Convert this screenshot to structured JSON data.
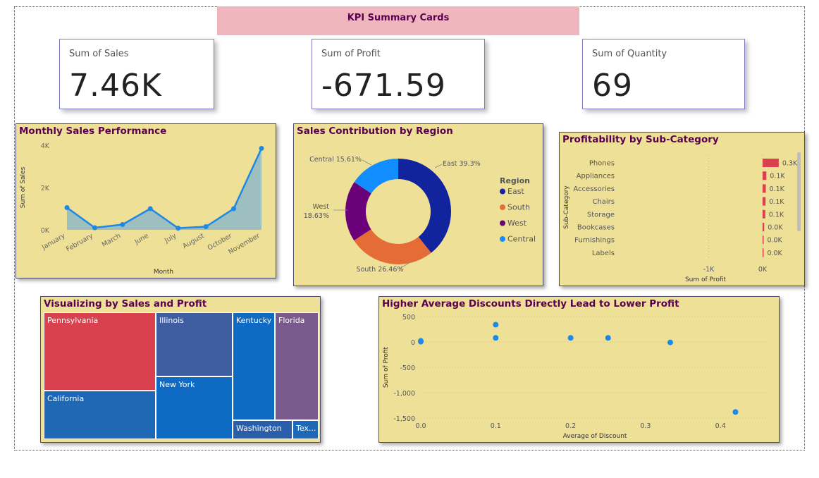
{
  "banner": {
    "title": "KPI Summary Cards"
  },
  "kpis": [
    {
      "label": "Sum of Sales",
      "value": "7.46K"
    },
    {
      "label": "Sum of Profit",
      "value": "-671.59"
    },
    {
      "label": "Sum of Quantity",
      "value": "69"
    }
  ],
  "colors": {
    "panel_bg": "#eee096",
    "title": "#5a0050",
    "line": "#1e88e5",
    "area": "#8fb8c8",
    "bar": "#d9414e"
  },
  "chart_data": [
    {
      "type": "area",
      "title": "Monthly Sales Performance",
      "xlabel": "Month",
      "ylabel": "Sum of Sales",
      "categories": [
        "January",
        "February",
        "March",
        "June",
        "July",
        "August",
        "October",
        "November"
      ],
      "values": [
        1050,
        100,
        250,
        1000,
        80,
        150,
        1000,
        3850
      ],
      "y_ticks": [
        "0K",
        "2K",
        "4K"
      ],
      "ylim": [
        0,
        4000
      ],
      "grid": false
    },
    {
      "type": "pie",
      "title": "Sales Contribution by Region",
      "legend_title": "Region",
      "legend_position": "right",
      "slices": [
        {
          "name": "East",
          "value": 39.3,
          "label": "East 39.3%",
          "color": "#12239e"
        },
        {
          "name": "South",
          "value": 26.46,
          "label": "South 26.46%",
          "color": "#e66c37"
        },
        {
          "name": "West",
          "value": 18.63,
          "label_line1": "West",
          "label_line2": "18.63%",
          "color": "#6b007b"
        },
        {
          "name": "Central",
          "value": 15.61,
          "label": "Central 15.61%",
          "color": "#118dff"
        }
      ]
    },
    {
      "type": "bar",
      "orientation": "horizontal",
      "title": "Profitability by Sub-Category",
      "xlabel": "Sum of Profit",
      "ylabel": "Sub-Category",
      "categories": [
        "Phones",
        "Appliances",
        "Accessories",
        "Chairs",
        "Storage",
        "Bookcases",
        "Furnishings",
        "Labels"
      ],
      "values": [
        300,
        70,
        60,
        55,
        50,
        30,
        8,
        5
      ],
      "data_labels": [
        "0.3K",
        "0.1K",
        "0.1K",
        "0.1K",
        "0.1K",
        "0.0K",
        "0.0K",
        "0.0K"
      ],
      "x_ticks": [
        "-1K",
        "0K"
      ],
      "xlim": [
        -1700,
        550
      ]
    },
    {
      "type": "treemap",
      "title": "Visualizing by Sales and Profit",
      "nodes": [
        {
          "name": "Pennsylvania",
          "color": "#d9414e"
        },
        {
          "name": "California",
          "color": "#1e68b5"
        },
        {
          "name": "Illinois",
          "color": "#3f5ea2"
        },
        {
          "name": "New York",
          "color": "#0f6ac4"
        },
        {
          "name": "Kentucky",
          "color": "#0f6ac4"
        },
        {
          "name": "Florida",
          "color": "#7a5a8c"
        },
        {
          "name": "Washington",
          "color": "#2a5ea8"
        },
        {
          "name": "Tex...",
          "color": "#1e68b5"
        }
      ]
    },
    {
      "type": "scatter",
      "title": "Higher Average Discounts Directly Lead to Lower Profit",
      "xlabel": "Average of Discount",
      "ylabel": "Sum of Profit",
      "x_ticks": [
        "0.0",
        "0.1",
        "0.2",
        "0.3",
        "0.4"
      ],
      "y_ticks": [
        "500",
        "0",
        "-500",
        "-1,000",
        "-1,500"
      ],
      "xlim": [
        0,
        0.46
      ],
      "ylim": [
        -1500,
        500
      ],
      "points": [
        {
          "x": 0.0,
          "y": 20
        },
        {
          "x": 0.0,
          "y": 5
        },
        {
          "x": 0.1,
          "y": 340
        },
        {
          "x": 0.1,
          "y": 80
        },
        {
          "x": 0.2,
          "y": 80
        },
        {
          "x": 0.25,
          "y": 80
        },
        {
          "x": 0.333,
          "y": -10
        },
        {
          "x": 0.42,
          "y": -1380
        }
      ]
    }
  ]
}
